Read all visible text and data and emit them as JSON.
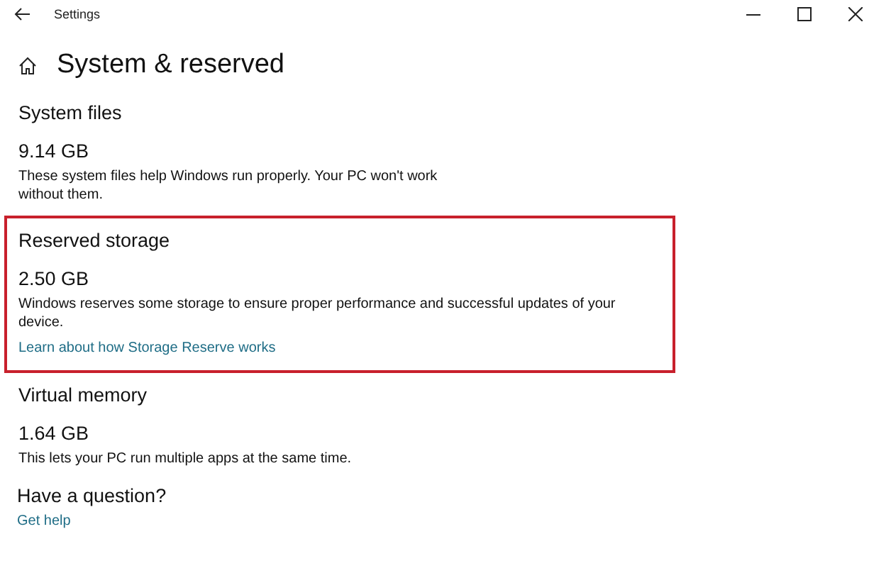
{
  "window": {
    "title": "Settings"
  },
  "page": {
    "title": "System & reserved"
  },
  "sections": [
    {
      "heading": "System files",
      "size": "9.14 GB",
      "description": "These system files help Windows run properly. Your PC won't work without them.",
      "highlighted": false
    },
    {
      "heading": "Reserved storage",
      "size": "2.50 GB",
      "description": "Windows reserves some storage to ensure proper performance and successful updates of your device.",
      "link": "Learn about how Storage Reserve works",
      "highlighted": true
    },
    {
      "heading": "Virtual memory",
      "size": "1.64 GB",
      "description": "This lets your PC run multiple apps at the same time.",
      "highlighted": false
    }
  ],
  "help": {
    "heading": "Have a question?",
    "link": "Get help"
  }
}
